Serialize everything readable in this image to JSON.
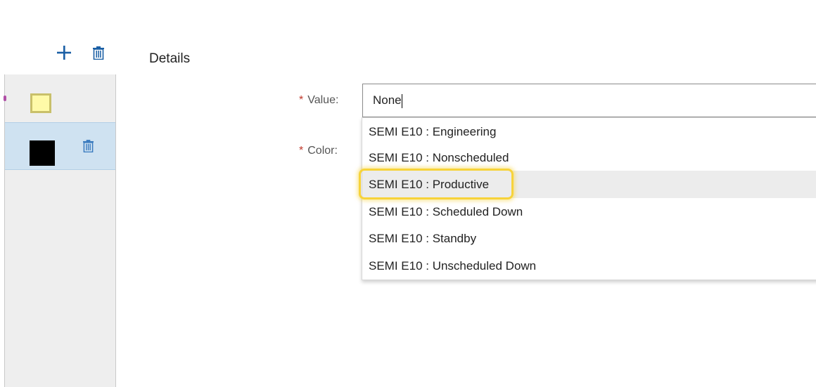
{
  "toolbar": {
    "add_icon": "plus-icon",
    "delete_icon": "trash-icon"
  },
  "colors": {
    "accent": "#1a5fa5",
    "selected_row": "#cfe2f1",
    "required": "#c0392b",
    "highlight": "#f7d33a"
  },
  "list": {
    "rows": [
      {
        "swatch_color": "#fffaa8",
        "selected": false
      },
      {
        "swatch_color": "#000000",
        "selected": true
      }
    ]
  },
  "details": {
    "title": "Details",
    "value_label": "Value:",
    "color_label": "Color:",
    "required_mark": "*",
    "value_input": "None"
  },
  "dropdown": {
    "options": [
      "SEMI E10 : Engineering",
      "SEMI E10 : Nonscheduled",
      "SEMI E10 : Productive",
      "SEMI E10 : Scheduled Down",
      "SEMI E10 : Standby",
      "SEMI E10 : Unscheduled Down"
    ],
    "hovered_index": 2
  }
}
